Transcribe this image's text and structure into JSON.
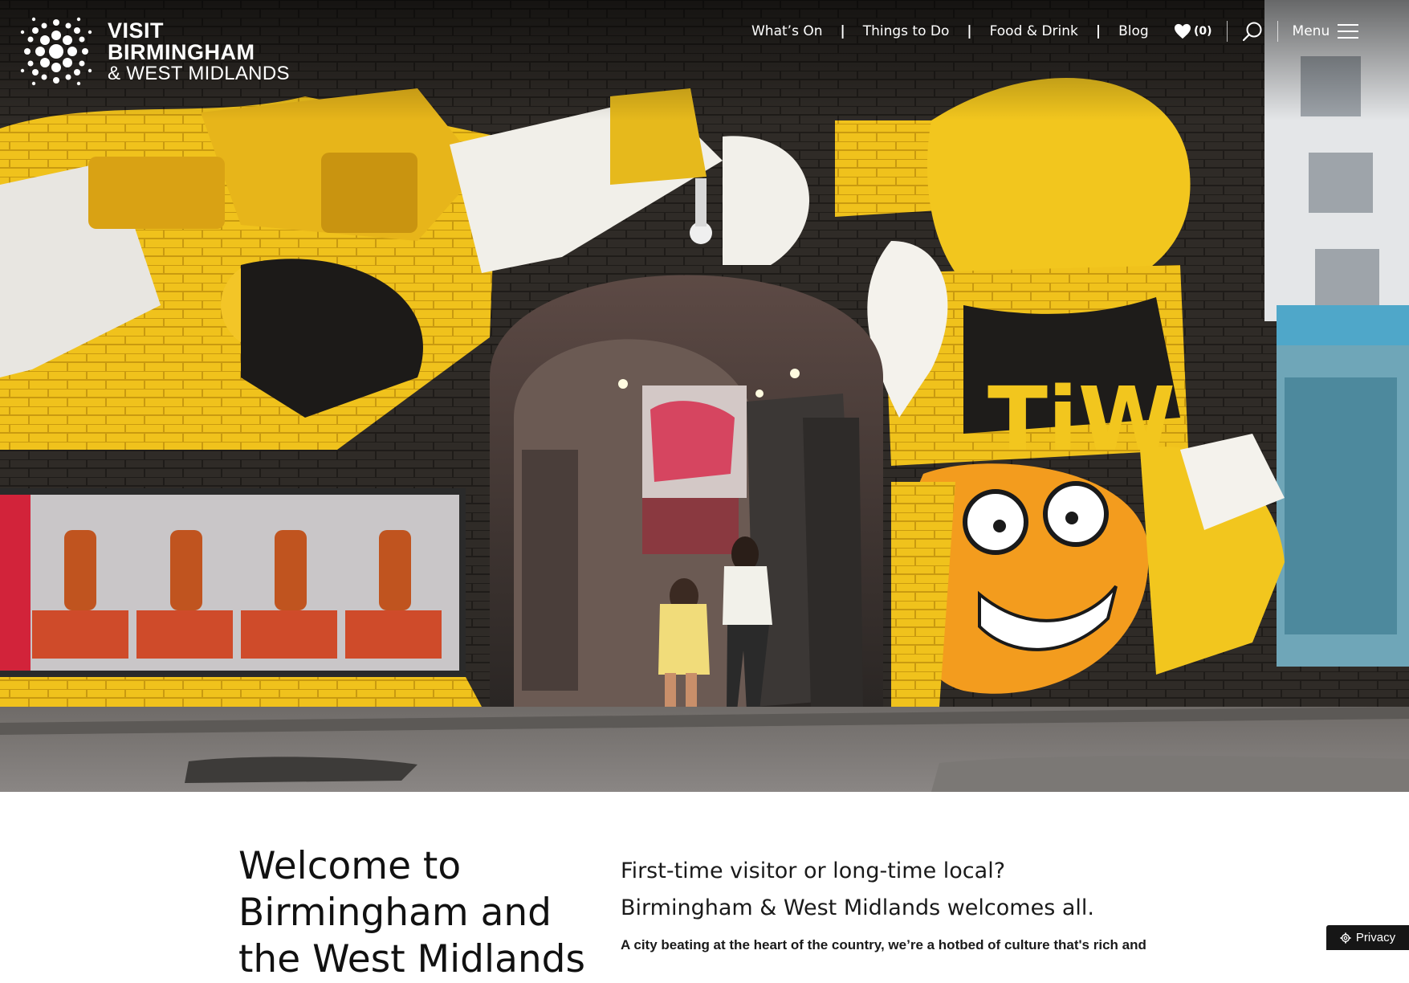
{
  "logo": {
    "line1": "VISIT",
    "line2": "BIRMINGHAM",
    "line3": "& WEST MIDLANDS"
  },
  "nav": {
    "items": [
      {
        "label": "What’s On"
      },
      {
        "label": "Things to Do"
      },
      {
        "label": "Food & Drink"
      },
      {
        "label": "Blog"
      }
    ],
    "separator": "|"
  },
  "tools": {
    "favorites_count": "(0)",
    "favorites_icon": "heart-icon",
    "search_icon": "search-icon",
    "menu_label": "Menu",
    "menu_icon": "hamburger-icon"
  },
  "hero": {
    "image": "street-art-railway-arch-with-two-women-walking"
  },
  "intro": {
    "title": "Welcome to Birmingham and the West Midlands",
    "lead_line1": "First-time visitor or long-time local?",
    "lead_line2": "Birmingham & West Midlands welcomes all.",
    "body": "A city beating at the heart of the country, we’re a hotbed of culture that's rich and"
  },
  "privacy": {
    "label": "Privacy",
    "icon": "gear-icon"
  },
  "colors": {
    "accent_yellow": "#f2c21a",
    "text_dark": "#111111",
    "hero_brick": "#2b2825"
  }
}
